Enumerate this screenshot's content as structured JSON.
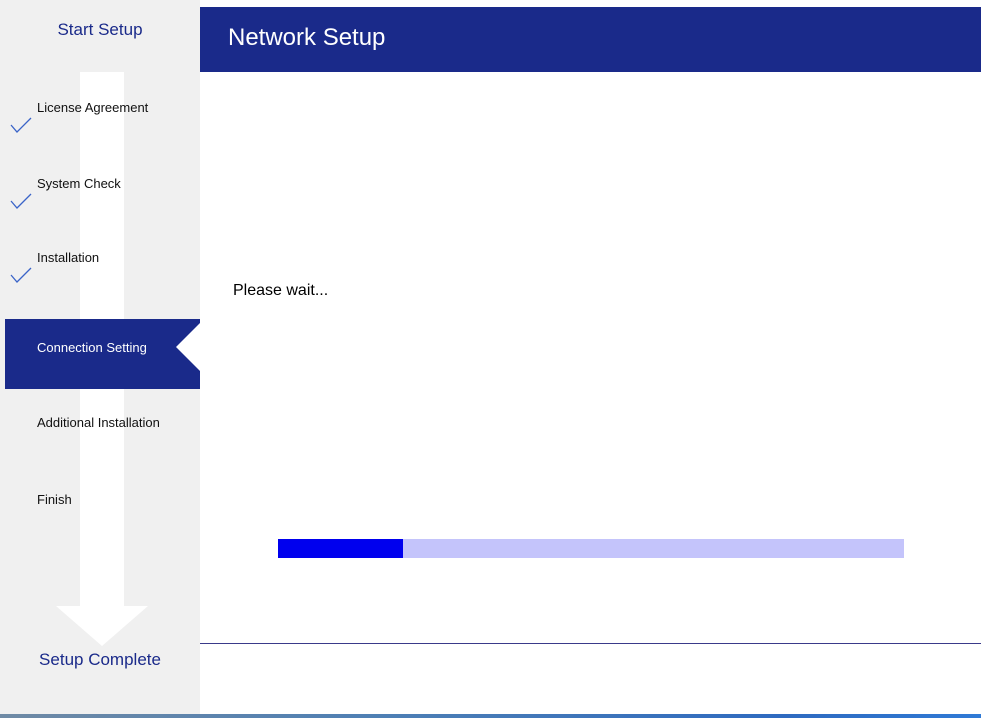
{
  "sidebar": {
    "title": "Start Setup",
    "footer": "Setup Complete",
    "steps": [
      {
        "label": "License Agreement",
        "state": "done"
      },
      {
        "label": "System Check",
        "state": "done"
      },
      {
        "label": "Installation",
        "state": "done"
      },
      {
        "label": "Connection Setting",
        "state": "active"
      },
      {
        "label": "Additional Installation",
        "state": "pending"
      },
      {
        "label": "Finish",
        "state": "pending"
      }
    ]
  },
  "header": {
    "title": "Network Setup"
  },
  "main": {
    "status": "Please wait...",
    "progress": 0.2
  },
  "colors": {
    "brand": "#1a2a8a",
    "progress_fill": "#0000ee",
    "progress_track": "#c4c4fb",
    "check": "#3a64c8"
  },
  "icons": {
    "check": "check-icon",
    "flow_arrow": "down-arrow-icon"
  }
}
